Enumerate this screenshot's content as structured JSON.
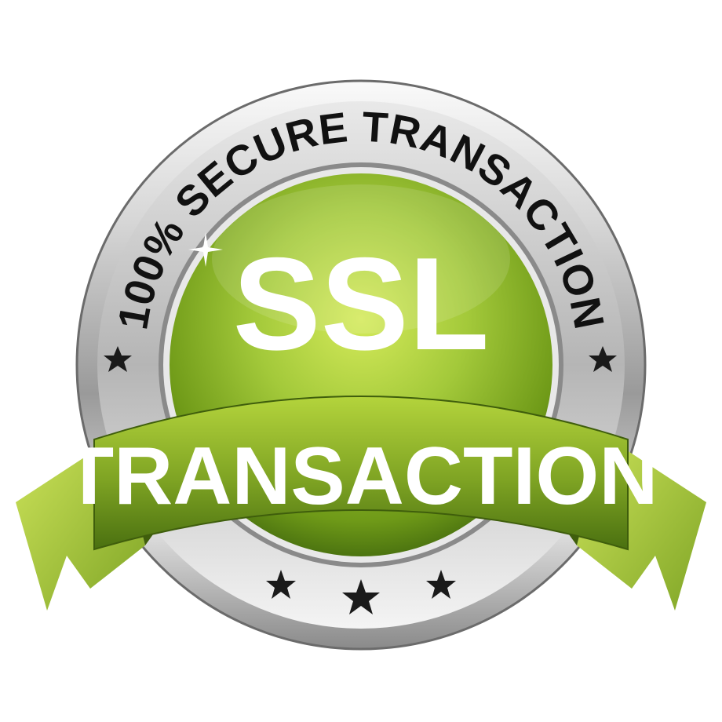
{
  "badge": {
    "ring_text": "100% SECURE TRANSACTION",
    "center_text": "SSL",
    "ribbon_text": "TRANSACTION"
  },
  "icons": {
    "side_stars": "star-icon",
    "bottom_stars": "star-icon",
    "sparkle": "sparkle-icon"
  },
  "colors": {
    "green_light": "#c9e04a",
    "green_mid": "#8db82a",
    "green_dark": "#4f7a0f",
    "silver_light": "#f2f2f2",
    "silver_dark": "#7d7d7d",
    "text_dark": "#111111",
    "text_light": "#ffffff"
  }
}
